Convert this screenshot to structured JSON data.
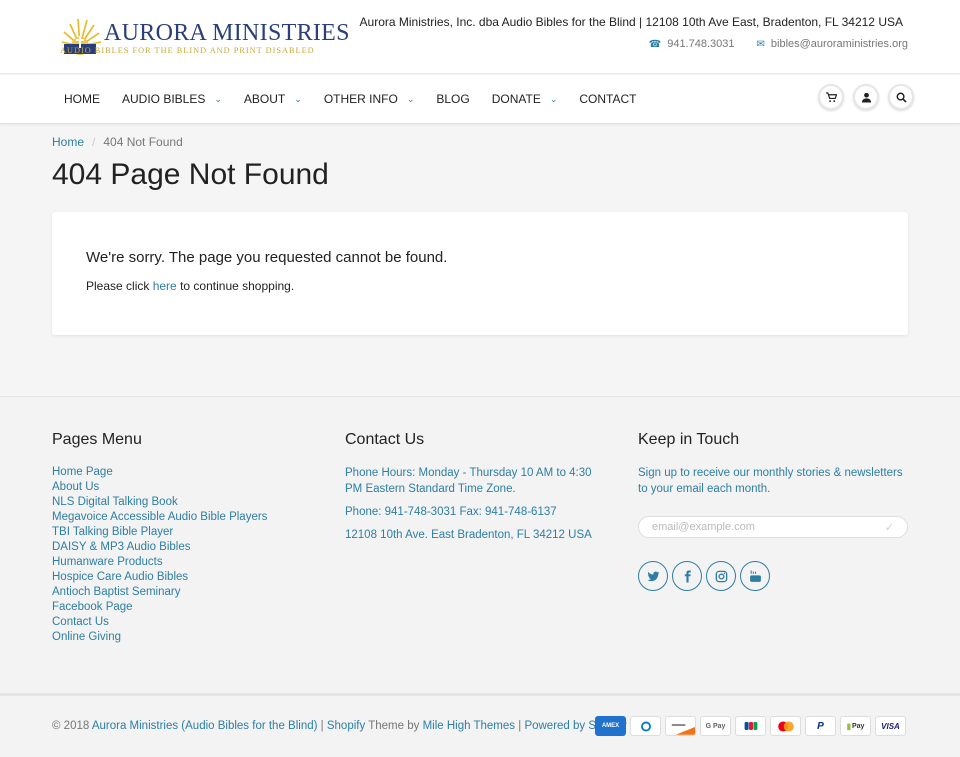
{
  "header": {
    "logo_name": "AURORA MINISTRIES",
    "logo_tagline": "AUDIO BIBLES FOR THE BLIND AND PRINT DISABLED",
    "info_line": "Aurora Ministries, Inc. dba Audio Bibles for the Blind | 12108 10th Ave East, Bradenton, FL 34212 USA",
    "phone": "941.748.3031",
    "email": "bibles@auroraministries.org"
  },
  "nav": {
    "items": [
      {
        "label": "HOME",
        "dropdown": false
      },
      {
        "label": "AUDIO BIBLES",
        "dropdown": true
      },
      {
        "label": "ABOUT",
        "dropdown": true
      },
      {
        "label": "OTHER INFO",
        "dropdown": true
      },
      {
        "label": "BLOG",
        "dropdown": false
      },
      {
        "label": "DONATE",
        "dropdown": true
      },
      {
        "label": "CONTACT",
        "dropdown": false
      }
    ],
    "icons": [
      "cart-icon",
      "user-icon",
      "search-icon"
    ]
  },
  "breadcrumb": {
    "home": "Home",
    "separator": "/",
    "current": "404 Not Found"
  },
  "page_title": "404 Page Not Found",
  "message": {
    "sorry": "We're sorry. The page you requested cannot be found.",
    "please_before": "Please click",
    "link": "here",
    "please_after": "to continue shopping."
  },
  "footer": {
    "pages_menu": {
      "title": "Pages Menu",
      "links": [
        "Home Page",
        "About Us",
        "NLS Digital Talking Book",
        "Megavoice Accessible Audio Bible Players",
        "TBI Talking Bible Player",
        "DAISY & MP3 Audio Bibles",
        "Humanware Products",
        "Hospice Care Audio Bibles",
        "Antioch Baptist Seminary",
        "Facebook Page",
        "Contact Us",
        "Online Giving"
      ]
    },
    "contact": {
      "title": "Contact Us",
      "hours": "Phone Hours: Monday - Thursday 10 AM to 4:30 PM Eastern Standard Time Zone.",
      "phone": "Phone: 941-748-3031 Fax: 941-748-6137",
      "address": "12108 10th Ave. East Bradenton, FL 34212 USA"
    },
    "keep_in_touch": {
      "title": "Keep in Touch",
      "text": "Sign up to receive our monthly stories & newsletters to your email each month.",
      "email_placeholder": "email@example.com",
      "socials": [
        "twitter-icon",
        "facebook-icon",
        "instagram-icon",
        "youtube-icon"
      ]
    }
  },
  "bottom": {
    "copyright": "© 2018",
    "store_link": "Aurora Ministries (Audio Bibles for the Blind)",
    "sep1": "|",
    "shopify": "Shopify",
    "theme_by": "Theme by",
    "theme_link": "Mile High Themes",
    "sep2": "|",
    "powered": "Powered by Shopify",
    "payments": [
      "amex-icon",
      "diners-icon",
      "discover-icon",
      "google-pay-icon",
      "jcb-icon",
      "mastercard-icon",
      "paypal-icon",
      "shopify-pay-icon",
      "visa-icon"
    ],
    "payment_labels": [
      "AMEX",
      "",
      "",
      "G Pay",
      "",
      "",
      "P",
      "Pay",
      "VISA"
    ]
  },
  "colors": {
    "link": "#2d7ea4",
    "logo_blue": "#2a3f7a",
    "logo_gold": "#c9a83a"
  }
}
